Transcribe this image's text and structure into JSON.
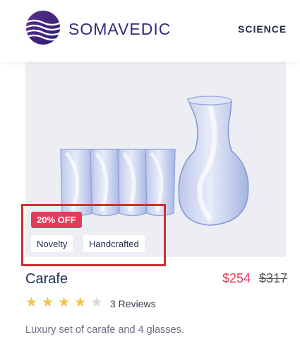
{
  "header": {
    "brand": "SOMAVEDIC",
    "nav_science": "SCIENCE"
  },
  "product": {
    "discount_badge": "20% OFF",
    "tags": [
      "Novelty",
      "Handcrafted"
    ],
    "title": "Carafe",
    "price": "$254",
    "old_price": "$317",
    "rating": 4,
    "rating_max": 5,
    "reviews_label": "3 Reviews",
    "description": "Luxury set of carafe and 4 glasses."
  },
  "colors": {
    "brand": "#3b2a7a",
    "accent": "#e63a5c",
    "star": "#f0c14b",
    "highlight_box": "#d32f2f"
  }
}
